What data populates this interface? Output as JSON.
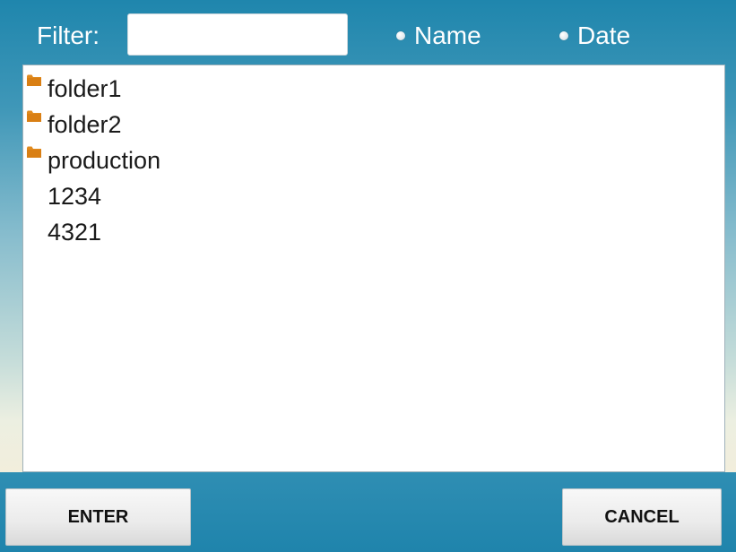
{
  "filter": {
    "label": "Filter:",
    "value": "",
    "placeholder": ""
  },
  "sort": {
    "options": [
      {
        "label": "Name",
        "selected": false
      },
      {
        "label": "Date",
        "selected": false
      }
    ]
  },
  "list": {
    "items": [
      {
        "label": "folder1",
        "type": "folder",
        "icon": "folder-icon"
      },
      {
        "label": "folder2",
        "type": "folder",
        "icon": "folder-icon"
      },
      {
        "label": "production",
        "type": "folder",
        "icon": "folder-icon"
      },
      {
        "label": "1234",
        "type": "file",
        "icon": ""
      },
      {
        "label": "4321",
        "type": "file",
        "icon": ""
      }
    ]
  },
  "buttons": {
    "enter_label": "ENTER",
    "cancel_label": "CANCEL"
  },
  "colors": {
    "header_blue": "#1f86ad",
    "footer_blue": "#2f8eb3",
    "folder_orange": "#e08a1e"
  }
}
